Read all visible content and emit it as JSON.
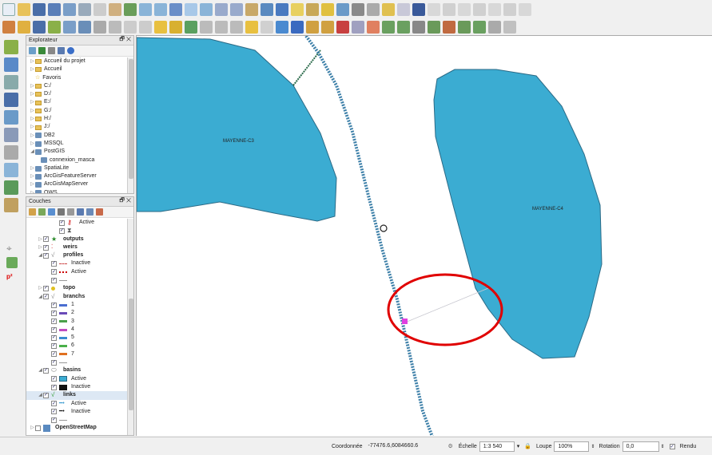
{
  "explorer": {
    "title": "Explorateur",
    "items": [
      {
        "label": "Accueil du projet",
        "icon": "folder-icon"
      },
      {
        "label": "Accueil",
        "icon": "folder-icon"
      },
      {
        "label": "Favoris",
        "icon": "star-icon"
      },
      {
        "label": "C:/",
        "icon": "folder-icon"
      },
      {
        "label": "D:/",
        "icon": "folder-icon"
      },
      {
        "label": "E:/",
        "icon": "folder-icon"
      },
      {
        "label": "G:/",
        "icon": "folder-icon"
      },
      {
        "label": "H:/",
        "icon": "folder-icon"
      },
      {
        "label": "J:/",
        "icon": "folder-icon"
      },
      {
        "label": "DB2",
        "icon": "database-icon"
      },
      {
        "label": "MSSQL",
        "icon": "database-icon"
      },
      {
        "label": "PostGIS",
        "icon": "elephant-icon"
      },
      {
        "label": "connexion_masca",
        "icon": "connection-icon"
      },
      {
        "label": "SpatiaLite",
        "icon": "feather-icon"
      },
      {
        "label": "ArcGisFeatureServer",
        "icon": "globe-icon"
      },
      {
        "label": "ArcGisMapServer",
        "icon": "globe-icon"
      },
      {
        "label": "OWS",
        "icon": "globe-icon"
      }
    ]
  },
  "layers": {
    "title": "Couches",
    "items": [
      {
        "label": "Active",
        "indent": 3,
        "checked": true,
        "bold": false,
        "sym": "dot-red"
      },
      {
        "label": "",
        "indent": 3,
        "checked": true,
        "bold": false,
        "sym": "hourglass"
      },
      {
        "label": "outputs",
        "indent": 1,
        "checked": true,
        "bold": true,
        "sym": "star-green"
      },
      {
        "label": "weirs",
        "indent": 1,
        "checked": true,
        "bold": true,
        "sym": "dots"
      },
      {
        "label": "profiles",
        "indent": 1,
        "checked": true,
        "bold": true,
        "sym": "line-v",
        "expanded": true
      },
      {
        "label": "Inactive",
        "indent": 2,
        "checked": true,
        "bold": false,
        "sym": "dash-red"
      },
      {
        "label": "Active",
        "indent": 2,
        "checked": true,
        "bold": false,
        "sym": "dash-red2"
      },
      {
        "label": "",
        "indent": 2,
        "checked": true,
        "bold": false,
        "sym": "dash-gray"
      },
      {
        "label": "topo",
        "indent": 1,
        "checked": true,
        "bold": true,
        "sym": "dot-yellow"
      },
      {
        "label": "branchs",
        "indent": 1,
        "checked": true,
        "bold": true,
        "sym": "line-v",
        "expanded": true
      },
      {
        "label": "1",
        "indent": 2,
        "checked": true,
        "bold": false,
        "sym": "c1"
      },
      {
        "label": "2",
        "indent": 2,
        "checked": true,
        "bold": false,
        "sym": "c2"
      },
      {
        "label": "3",
        "indent": 2,
        "checked": true,
        "bold": false,
        "sym": "c3"
      },
      {
        "label": "4",
        "indent": 2,
        "checked": true,
        "bold": false,
        "sym": "c4"
      },
      {
        "label": "5",
        "indent": 2,
        "checked": true,
        "bold": false,
        "sym": "c5"
      },
      {
        "label": "6",
        "indent": 2,
        "checked": true,
        "bold": false,
        "sym": "c6"
      },
      {
        "label": "7",
        "indent": 2,
        "checked": true,
        "bold": false,
        "sym": "c7"
      },
      {
        "label": "",
        "indent": 2,
        "checked": true,
        "bold": false,
        "sym": "dash-gray"
      },
      {
        "label": "basins",
        "indent": 1,
        "checked": true,
        "bold": true,
        "sym": "poly",
        "expanded": true
      },
      {
        "label": "Active",
        "indent": 2,
        "checked": true,
        "bold": false,
        "sym": "fill-blue"
      },
      {
        "label": "Inactive",
        "indent": 2,
        "checked": true,
        "bold": false,
        "sym": "fill-black"
      },
      {
        "label": "links",
        "indent": 1,
        "checked": true,
        "bold": true,
        "sym": "line-green",
        "expanded": true,
        "selected": true
      },
      {
        "label": "Active",
        "indent": 2,
        "checked": true,
        "bold": false,
        "sym": "link-active"
      },
      {
        "label": "Inactive",
        "indent": 2,
        "checked": true,
        "bold": false,
        "sym": "link-inactive"
      },
      {
        "label": "",
        "indent": 2,
        "checked": true,
        "bold": false,
        "sym": "dash-gray"
      },
      {
        "label": "OpenStreetMap",
        "indent": 0,
        "checked": false,
        "bold": true,
        "sym": "osm"
      }
    ]
  },
  "map": {
    "labels": {
      "left_basin": "MAYENNE-C3",
      "right_basin": "MAYENNE-C4"
    },
    "colors": {
      "basin_fill": "#3bacd2",
      "basin_stroke": "#2b6a86",
      "river": "#3c7fa8",
      "annotation": "#e00000"
    }
  },
  "status": {
    "coord_label": "Coordonnée",
    "coord_value": "-77476.6,6084660.6",
    "scale_label": "Échelle",
    "scale_value": "1:3 540",
    "magnifier_label": "Loupe",
    "magnifier_value": "100%",
    "rotation_label": "Rotation",
    "rotation_value": "0,0",
    "render_label": "Rendu"
  }
}
